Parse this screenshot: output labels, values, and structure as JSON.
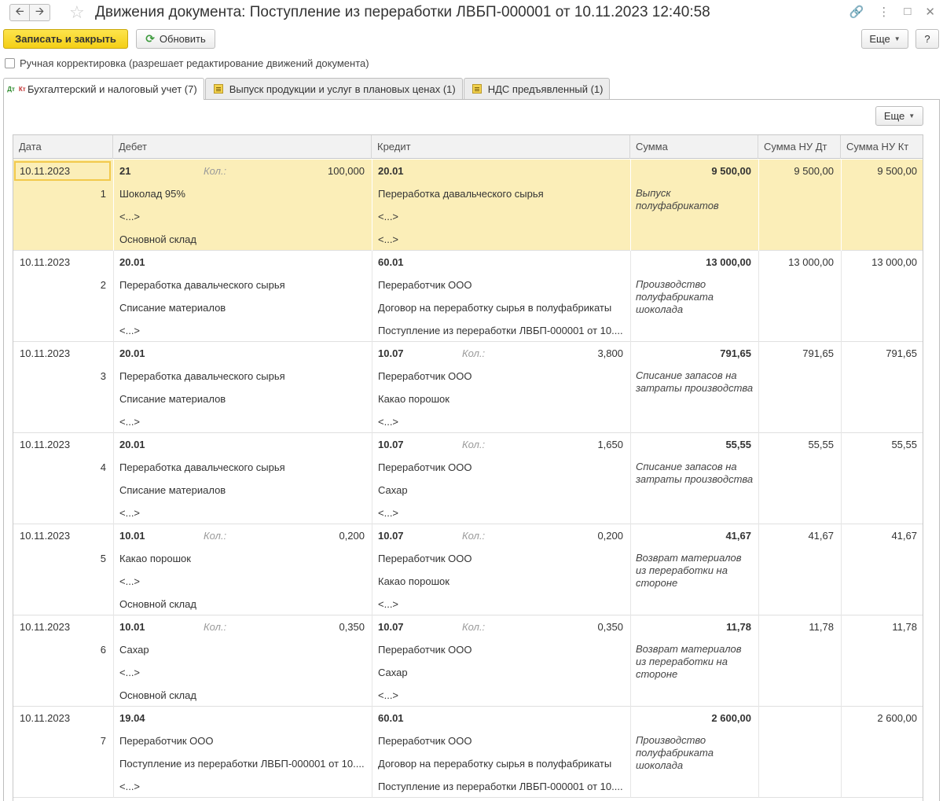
{
  "window": {
    "title": "Движения документа: Поступление из переработки ЛВБП-000001 от 10.11.2023 12:40:58"
  },
  "toolbar": {
    "save_close": "Записать и закрыть",
    "refresh": "Обновить",
    "more": "Еще",
    "help": "?"
  },
  "manual_edit": {
    "label": "Ручная корректировка (разрешает редактирование движений документа)"
  },
  "tabs": [
    {
      "label": "Бухгалтерский и налоговый учет (7)"
    },
    {
      "label": "Выпуск продукции и услуг в плановых ценах (1)"
    },
    {
      "label": "НДС предъявленный (1)"
    }
  ],
  "table": {
    "more": "Еще",
    "columns": {
      "date": "Дата",
      "debit": "Дебет",
      "credit": "Кредит",
      "sum": "Сумма",
      "sum_nu_dt": "Сумма НУ Дт",
      "sum_nu_kt": "Сумма НУ Кт"
    },
    "qty_label": "Кол.:",
    "rows": [
      {
        "date": "10.11.2023",
        "n": "1",
        "dt_account": "21",
        "dt_qty": "100,000",
        "dt_sub": [
          "Шоколад 95%",
          "<...>",
          "Основной склад"
        ],
        "kt_account": "20.01",
        "kt_qty": "",
        "kt_sub": [
          "Переработка давальческого сырья",
          "<...>",
          "<...>"
        ],
        "sum": "9 500,00",
        "desc": "Выпуск полуфабрикатов",
        "nu_dt": "9 500,00",
        "nu_kt": "9 500,00"
      },
      {
        "date": "10.11.2023",
        "n": "2",
        "dt_account": "20.01",
        "dt_qty": "",
        "dt_sub": [
          "Переработка давальческого сырья",
          "Списание материалов",
          "<...>"
        ],
        "kt_account": "60.01",
        "kt_qty": "",
        "kt_sub": [
          "Переработчик ООО",
          "Договор на переработку сырья в полуфабрикаты",
          "Поступление из переработки ЛВБП-000001 от 10...."
        ],
        "sum": "13 000,00",
        "desc": "Производство полуфабриката шоколада",
        "nu_dt": "13 000,00",
        "nu_kt": "13 000,00"
      },
      {
        "date": "10.11.2023",
        "n": "3",
        "dt_account": "20.01",
        "dt_qty": "",
        "dt_sub": [
          "Переработка давальческого сырья",
          "Списание материалов",
          "<...>"
        ],
        "kt_account": "10.07",
        "kt_qty": "3,800",
        "kt_sub": [
          "Переработчик ООО",
          "Какао порошок",
          "<...>"
        ],
        "sum": "791,65",
        "desc": "Списание запасов на затраты производства",
        "nu_dt": "791,65",
        "nu_kt": "791,65"
      },
      {
        "date": "10.11.2023",
        "n": "4",
        "dt_account": "20.01",
        "dt_qty": "",
        "dt_sub": [
          "Переработка давальческого сырья",
          "Списание материалов",
          "<...>"
        ],
        "kt_account": "10.07",
        "kt_qty": "1,650",
        "kt_sub": [
          "Переработчик ООО",
          "Сахар",
          "<...>"
        ],
        "sum": "55,55",
        "desc": "Списание запасов на затраты производства",
        "nu_dt": "55,55",
        "nu_kt": "55,55"
      },
      {
        "date": "10.11.2023",
        "n": "5",
        "dt_account": "10.01",
        "dt_qty": "0,200",
        "dt_sub": [
          "Какао порошок",
          "<...>",
          "Основной склад"
        ],
        "kt_account": "10.07",
        "kt_qty": "0,200",
        "kt_sub": [
          "Переработчик ООО",
          "Какао порошок",
          "<...>"
        ],
        "sum": "41,67",
        "desc": "Возврат материалов из переработки на стороне",
        "nu_dt": "41,67",
        "nu_kt": "41,67"
      },
      {
        "date": "10.11.2023",
        "n": "6",
        "dt_account": "10.01",
        "dt_qty": "0,350",
        "dt_sub": [
          "Сахар",
          "<...>",
          "Основной склад"
        ],
        "kt_account": "10.07",
        "kt_qty": "0,350",
        "kt_sub": [
          "Переработчик ООО",
          "Сахар",
          "<...>"
        ],
        "sum": "11,78",
        "desc": "Возврат материалов из переработки на стороне",
        "nu_dt": "11,78",
        "nu_kt": "11,78"
      },
      {
        "date": "10.11.2023",
        "n": "7",
        "dt_account": "19.04",
        "dt_qty": "",
        "dt_sub": [
          "Переработчик ООО",
          "Поступление из переработки ЛВБП-000001 от 10....",
          "<...>"
        ],
        "kt_account": "60.01",
        "kt_qty": "",
        "kt_sub": [
          "Переработчик ООО",
          "Договор на переработку сырья в полуфабрикаты",
          "Поступление из переработки ЛВБП-000001 от 10...."
        ],
        "sum": "2 600,00",
        "desc": "Производство полуфабриката шоколада",
        "nu_dt": "",
        "nu_kt": "2 600,00"
      }
    ]
  }
}
